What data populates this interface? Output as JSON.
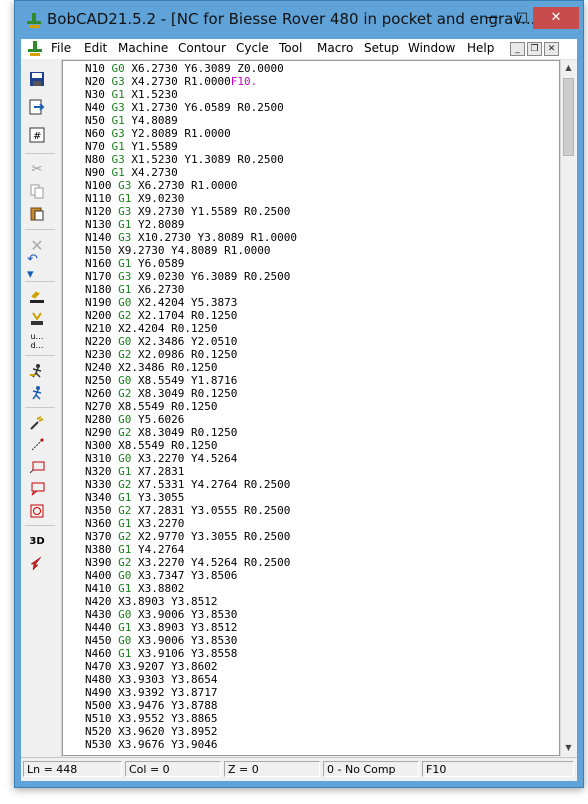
{
  "window": {
    "title": "BobCAD21.5.2 - [NC for Biesse Rover 480 in pocket and engrav...",
    "minimize_glyph": "—",
    "maximize_glyph": "□",
    "close_glyph": "✕"
  },
  "menu": {
    "items": [
      "File",
      "Edit",
      "Machine",
      "Contour",
      "Cycle",
      "Tool",
      "Macro",
      "Setup",
      "Window",
      "Help"
    ],
    "mdi_minimize": "_",
    "mdi_restore": "❐",
    "mdi_close": "✕"
  },
  "toolbar": {
    "tools": [
      "save-icon",
      "export-icon",
      "numbered-lines-icon",
      "cut-icon",
      "copy-icon",
      "paste-icon",
      "delete-icon",
      "undo-icon",
      "offset-icon",
      "pocket-icon",
      "line-numbering-icon",
      "simulate-icon",
      "run-icon",
      "drill-icon",
      "line-tool-icon",
      "box-select-icon",
      "speech-bubble-icon",
      "circle-select-icon",
      "3d-view-icon",
      "arrow-tool-icon"
    ],
    "label_3d": "3D"
  },
  "editor": {
    "lines": [
      "N10 G0 X6.2730 Y6.3089 Z0.0000",
      "N20 G3 X4.2730 R1.0000F10.",
      "N30 G1 X1.5230",
      "N40 G3 X1.2730 Y6.0589 R0.2500",
      "N50 G1 Y4.8089",
      "N60 G3 Y2.8089 R1.0000",
      "N70 G1 Y1.5589",
      "N80 G3 X1.5230 Y1.3089 R0.2500",
      "N90 G1 X4.2730",
      "N100 G3 X6.2730 R1.0000",
      "N110 G1 X9.0230",
      "N120 G3 X9.2730 Y1.5589 R0.2500",
      "N130 G1 Y2.8089",
      "N140 G3 X10.2730 Y3.8089 R1.0000",
      "N150 X9.2730 Y4.8089 R1.0000",
      "N160 G1 Y6.0589",
      "N170 G3 X9.0230 Y6.3089 R0.2500",
      "N180 G1 X6.2730",
      "N190 G0 X2.4204 Y5.3873",
      "N200 G2 X2.1704 R0.1250",
      "N210 X2.4204 R0.1250",
      "N220 G0 X2.3486 Y2.0510",
      "N230 G2 X2.0986 R0.1250",
      "N240 X2.3486 R0.1250",
      "N250 G0 X8.5549 Y1.8716",
      "N260 G2 X8.3049 R0.1250",
      "N270 X8.5549 R0.1250",
      "N280 G0 Y5.6026",
      "N290 G2 X8.3049 R0.1250",
      "N300 X8.5549 R0.1250",
      "N310 G0 X3.2270 Y4.5264",
      "N320 G1 X7.2831",
      "N330 G2 X7.5331 Y4.2764 R0.2500",
      "N340 G1 Y3.3055",
      "N350 G2 X7.2831 Y3.0555 R0.2500",
      "N360 G1 X3.2270",
      "N370 G2 X2.9770 Y3.3055 R0.2500",
      "N380 G1 Y4.2764",
      "N390 G2 X3.2270 Y4.5264 R0.2500",
      "N400 G0 X3.7347 Y3.8506",
      "N410 G1 X3.8802",
      "N420 X3.8903 Y3.8512",
      "N430 G0 X3.9006 Y3.8530",
      "N440 G1 X3.8903 Y3.8512",
      "N450 G0 X3.9006 Y3.8530",
      "N460 G1 X3.9106 Y3.8558",
      "N470 X3.9207 Y3.8602",
      "N480 X3.9303 Y3.8654",
      "N490 X3.9392 Y3.8717",
      "N500 X3.9476 Y3.8788",
      "N510 X3.9552 Y3.8865",
      "N520 X3.9620 Y3.8952",
      "N530 X3.9676 Y3.9046"
    ]
  },
  "status": {
    "ln": "Ln = 448",
    "col": "Col = 0",
    "z": "Z = 0",
    "comp": "0 - No Comp",
    "feed": "F10"
  },
  "colors": {
    "title_bar": "#5fa3d9",
    "g_code": "#1a7f1a",
    "feed_code": "#c000c0",
    "close_button": "#c94c4c"
  }
}
